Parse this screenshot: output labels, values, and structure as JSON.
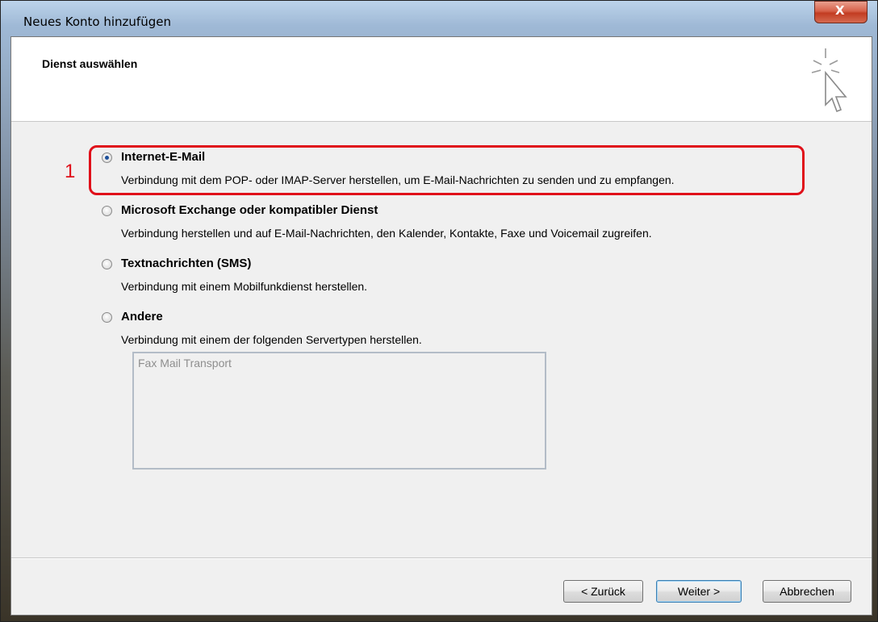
{
  "window": {
    "title": "Neues Konto hinzufügen",
    "close_glyph": "X"
  },
  "header": {
    "title": "Dienst auswählen",
    "icon": "wizard-cursor-icon"
  },
  "options": [
    {
      "label": "Internet-E-Mail",
      "description": "Verbindung mit dem POP- oder IMAP-Server herstellen, um E-Mail-Nachrichten zu senden und zu empfangen.",
      "selected": true
    },
    {
      "label": "Microsoft Exchange oder kompatibler Dienst",
      "description": "Verbindung herstellen und auf E-Mail-Nachrichten, den Kalender, Kontakte, Faxe und Voicemail zugreifen.",
      "selected": false
    },
    {
      "label": "Textnachrichten (SMS)",
      "description": "Verbindung mit einem Mobilfunkdienst herstellen.",
      "selected": false
    },
    {
      "label": "Andere",
      "description": "Verbindung mit einem der folgenden Servertypen herstellen.",
      "selected": false
    }
  ],
  "server_types": [
    "Fax Mail Transport"
  ],
  "annotation": {
    "number": "1",
    "color": "#e0101a"
  },
  "buttons": {
    "back": "< Zurück",
    "next": "Weiter >",
    "cancel": "Abbrechen"
  }
}
